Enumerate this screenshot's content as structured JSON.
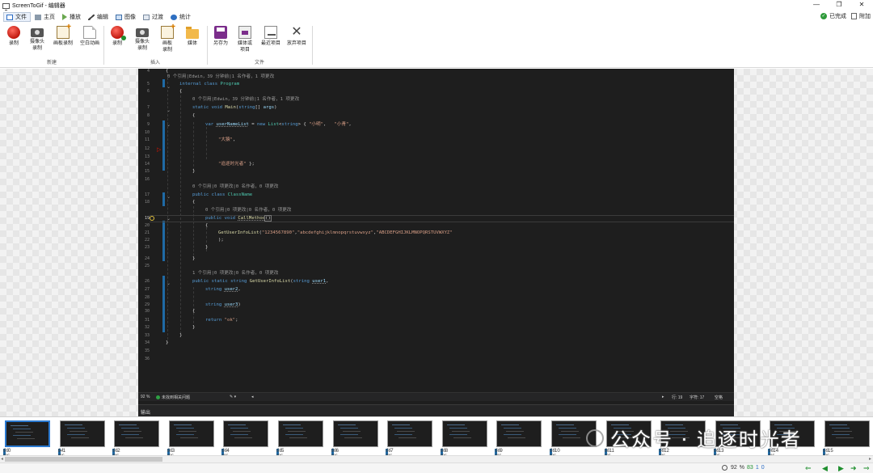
{
  "window": {
    "title": "ScreenToGif - 编辑器",
    "controls": [
      "—",
      "❐",
      "✕"
    ]
  },
  "tabs": [
    {
      "label": "文件",
      "icon": "file-icon",
      "active": true
    },
    {
      "label": "主页",
      "icon": "home-icon"
    },
    {
      "label": "播放",
      "icon": "play-icon"
    },
    {
      "label": "编辑",
      "icon": "edit-icon"
    },
    {
      "label": "图像",
      "icon": "image-icon"
    },
    {
      "label": "过渡",
      "icon": "transition-icon"
    },
    {
      "label": "统计",
      "icon": "stats-icon"
    }
  ],
  "status_right": {
    "done_label": "已完成",
    "attach_label": "附加"
  },
  "ribbon": {
    "groups": [
      {
        "label": "新建",
        "buttons": [
          "录制",
          "摄像头\n录制",
          "画板录制",
          "空白动画"
        ]
      },
      {
        "label": "插入",
        "buttons": [
          "录制",
          "摄像头\n录制",
          "画板\n录制",
          "媒体"
        ]
      },
      {
        "label": "文件",
        "buttons": [
          "另存为",
          "媒体或\n项目",
          "最近项目",
          "放弃项目"
        ]
      }
    ]
  },
  "editor": {
    "line_numbers": [
      "4",
      "5",
      "6",
      "7",
      "8",
      "9",
      "10",
      "11",
      "12",
      "13",
      "14",
      "15",
      "16",
      "17",
      "18",
      "19",
      "20",
      "21",
      "22",
      "23",
      "24",
      "25",
      "26",
      "27",
      "28",
      "29",
      "30",
      "31",
      "32",
      "33",
      "34",
      "35",
      "36"
    ],
    "lines": {
      "l4": "{",
      "lens1": "0 个引用|Edwin，39 分钟前|1 名作者，1 项更改",
      "l5a": "internal ",
      "l5b": "class ",
      "l5c": "Program",
      "l6": "{",
      "lens2": "0 个引用|Edwin，39 分钟前|1 名作者，1 项更改",
      "l7a": "static ",
      "l7b": "void ",
      "l7c": "Main",
      "l7d": "(",
      "l7e": "string",
      "l7f": "[] ",
      "l7g": "args",
      "l7h": ")",
      "l8": "{",
      "l9a": "var ",
      "l9b": "userNameList",
      "l9c": " = ",
      "l9d": "new ",
      "l9e": "List",
      "l9f": "<",
      "l9g": "string",
      "l9h": "> { ",
      "l9i": "\"小明\"",
      "l9j": ",   ",
      "l9k": "\"小青\"",
      "l9l": ",",
      "l11": "\"大猿\"",
      "l11b": ",",
      "l14": "\"追逐时光者\"",
      "l14b": " };",
      "l15": "}",
      "lens3": "0 个引用|0 项更改|0 名作者，0 项更改",
      "l17a": "public ",
      "l17b": "class ",
      "l17c": "ClassName",
      "l18": "{",
      "lens4": "0 个引用|0 项更改|0 名作者，0 项更改",
      "l19a": "public ",
      "l19b": "void ",
      "l19c": "CallMethod",
      "l19d": "()",
      "l20": "{",
      "l21a": "GetUserInfoList",
      "l21b": "(",
      "l21c": "\"1234567890\"",
      "l21d": ",",
      "l21e": "\"abcdefghijklmnopqrstuvwxyz\"",
      "l21f": ",",
      "l21g": "\"ABCDEFGHIJKLMNOPQRSTUVWXYZ\"",
      "l22": ");",
      "l23": "}",
      "l24": "}",
      "lens5": "1 个引用|0 项更改|0 名作者，0 项更改",
      "l26a": "public ",
      "l26b": "static ",
      "l26c": "string ",
      "l26d": "GetUserInfoList",
      "l26e": "(",
      "l26f": "string ",
      "l26g": "user1",
      "l26h": ",",
      "l27a": "string ",
      "l27b": "user2",
      "l27c": ",",
      "l29a": "string ",
      "l29b": "user3",
      "l29c": ")",
      "l30": "{",
      "l31a": "return ",
      "l31b": "\"ok\"",
      "l31c": ";",
      "l32": "}",
      "l33": "}",
      "l34": "}"
    },
    "current_line": "19"
  },
  "vs_status": {
    "zoom": "92 %",
    "issues": "未找到相关问题",
    "row": "行: 19",
    "col": "字符: 17",
    "mode": "空格",
    "output_label": "输出"
  },
  "filmstrip": {
    "frames": [
      {
        "index": "0",
        "ms": "66 ms"
      },
      {
        "index": "1",
        "ms": "64 ms"
      },
      {
        "index": "2",
        "ms": "66 ms"
      },
      {
        "index": "3",
        "ms": "66 ms"
      },
      {
        "index": "4",
        "ms": "66 ms"
      },
      {
        "index": "5",
        "ms": "66 ms"
      },
      {
        "index": "6",
        "ms": "66 ms"
      },
      {
        "index": "7",
        "ms": "66 ms"
      },
      {
        "index": "8",
        "ms": "66 ms"
      },
      {
        "index": "9",
        "ms": "66 ms"
      },
      {
        "index": "10",
        "ms": "66 ms"
      },
      {
        "index": "11",
        "ms": "66 ms"
      },
      {
        "index": "12",
        "ms": "66 ms"
      },
      {
        "index": "13",
        "ms": "66 ms"
      },
      {
        "index": "14",
        "ms": "66 ms"
      },
      {
        "index": "15",
        "ms": "66 ms"
      }
    ],
    "watermark": "公众号 · 追逐时光者"
  },
  "bottom": {
    "zoom_value": "92",
    "zoom_unit": "%",
    "frame_count": "83",
    "selected_count": "1",
    "selected_index": "0"
  }
}
